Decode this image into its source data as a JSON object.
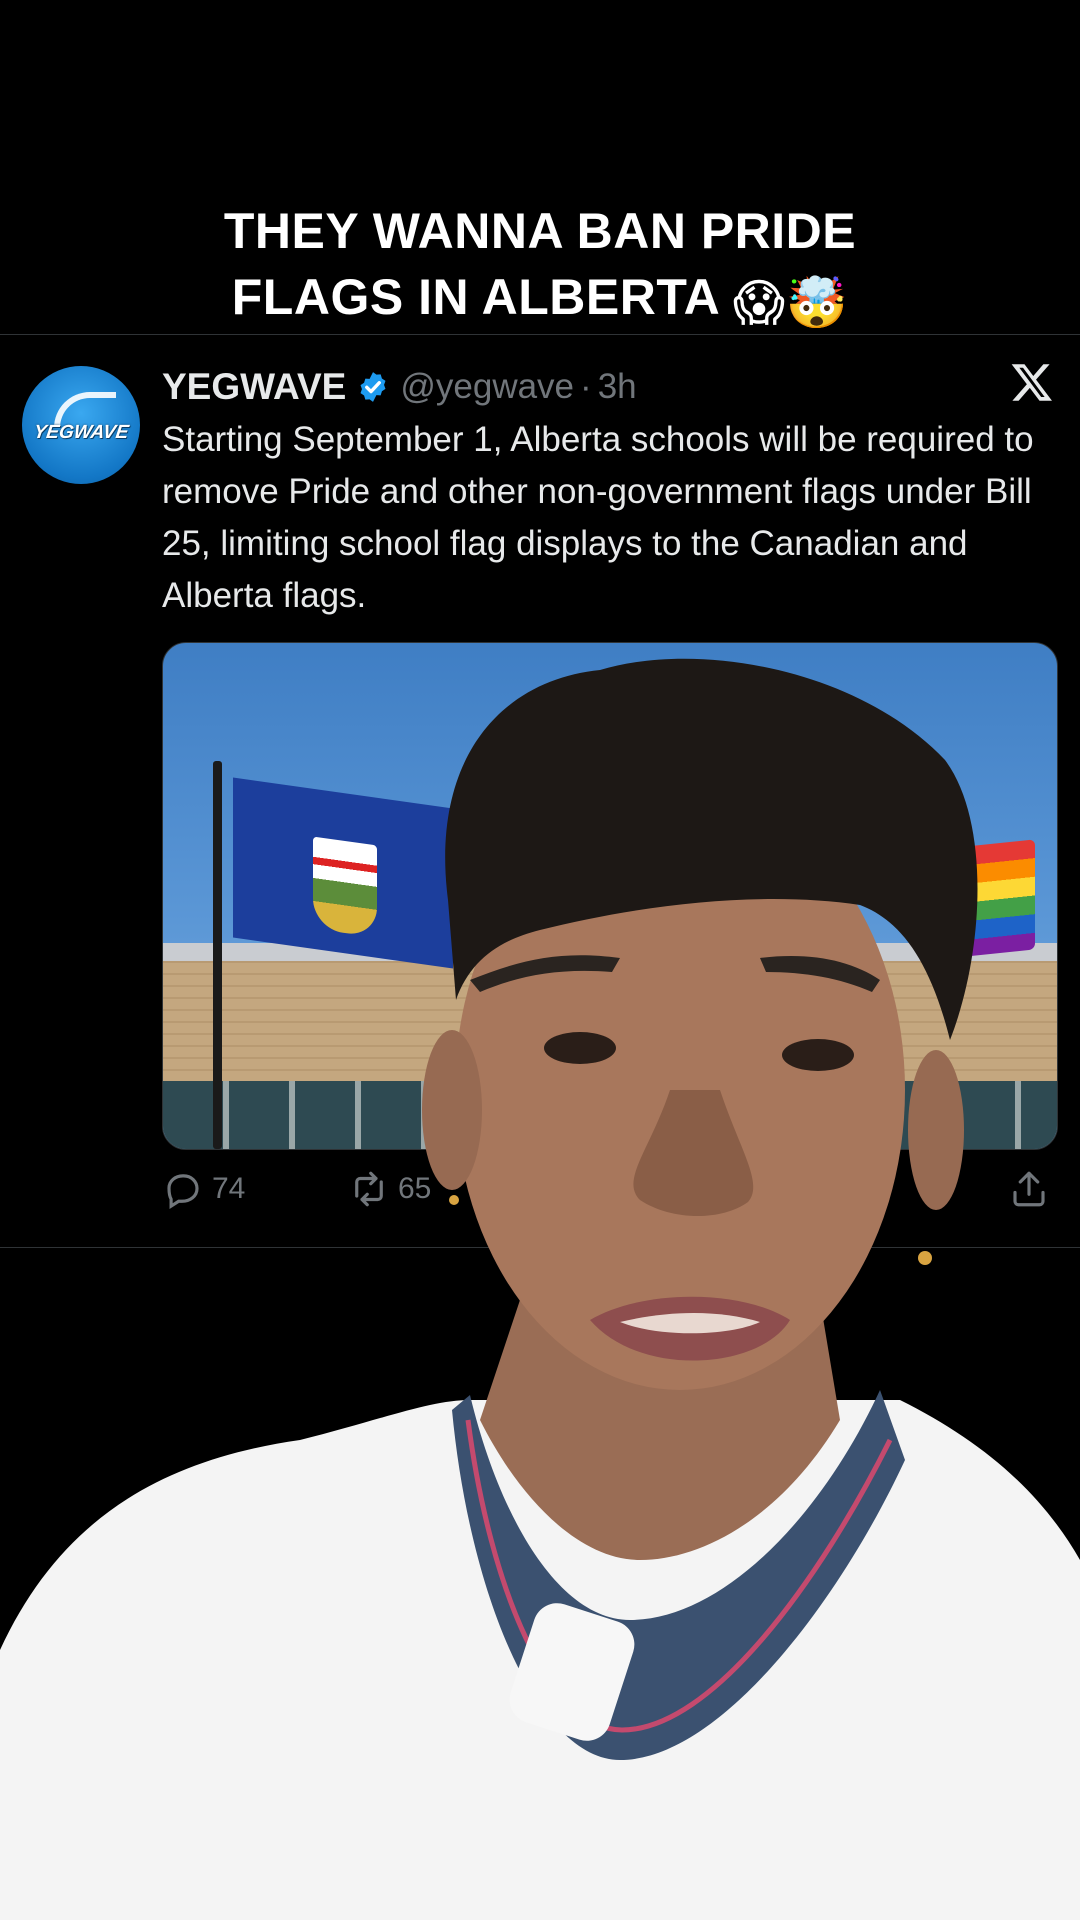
{
  "caption": {
    "line1": "THEY WANNA BAN PRIDE",
    "line2": "FLAGS IN ALBERTA",
    "emoji": "😱🤯"
  },
  "tweet": {
    "avatar_text": "YEGWAVE",
    "display_name": "YEGWAVE",
    "handle": "@yegwave",
    "separator": "·",
    "time": "3h",
    "text": "Starting September 1, Alberta schools will be required to remove Pride and other non-government flags under Bill 25, limiting school flag displays to the Canadian and Alberta flags.",
    "reply_count": "74",
    "retweet_count": "65"
  },
  "icons": {
    "verified": "verified-badge-icon",
    "platform": "x-logo-icon",
    "reply": "reply-icon",
    "retweet": "retweet-icon",
    "share": "share-icon"
  },
  "colors": {
    "background": "#000000",
    "verified": "#1d9bf0",
    "muted": "#71767b",
    "text": "#e7e9ea"
  }
}
